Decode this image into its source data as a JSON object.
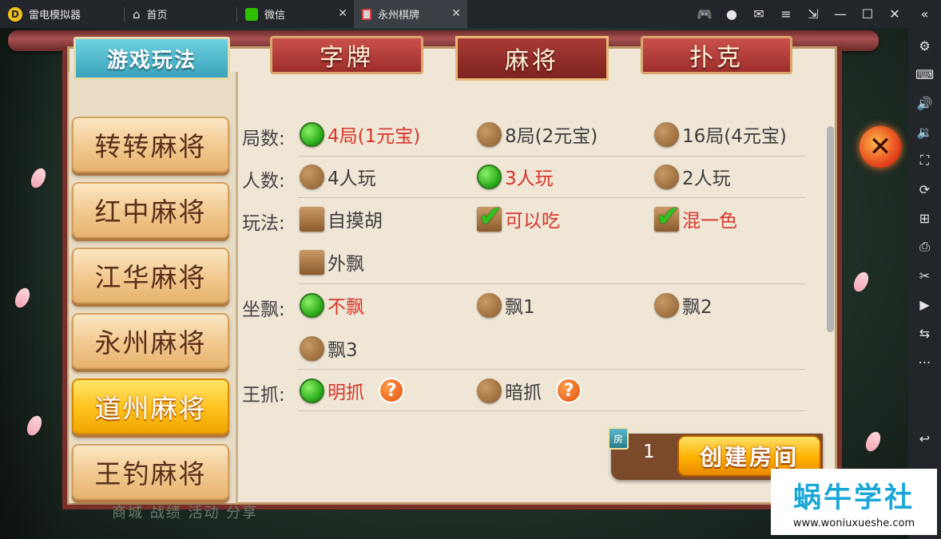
{
  "titlebar": {
    "tabs": [
      {
        "label": "雷电模拟器",
        "icon": "app-logo-icon"
      },
      {
        "label": "首页",
        "icon": "home-icon"
      },
      {
        "label": "微信",
        "icon": "wechat-icon"
      },
      {
        "label": "永州棋牌",
        "icon": "game-icon"
      }
    ],
    "close_glyph": "✕"
  },
  "game": {
    "rules_tab": "游戏玩法",
    "category_tabs": [
      {
        "label": "字牌"
      },
      {
        "label": "麻将"
      },
      {
        "label": "扑克"
      }
    ],
    "active_category": "麻将",
    "game_list": [
      {
        "label": "转转麻将"
      },
      {
        "label": "红中麻将"
      },
      {
        "label": "江华麻将"
      },
      {
        "label": "永州麻将"
      },
      {
        "label": "道州麻将"
      },
      {
        "label": "王钓麻将"
      }
    ],
    "active_game": "道州麻将",
    "rows": {
      "rounds": {
        "label": "局数:",
        "options": [
          "4局(1元宝)",
          "8局(2元宝)",
          "16局(4元宝)"
        ]
      },
      "players": {
        "label": "人数:",
        "options": [
          "4人玩",
          "3人玩",
          "2人玩"
        ]
      },
      "play": {
        "label": "玩法:",
        "options": [
          "自摸胡",
          "可以吃",
          "混一色",
          "外飘"
        ]
      },
      "piao": {
        "label": "坐飘:",
        "options": [
          "不飘",
          "飘1",
          "飘2",
          "飘3"
        ]
      },
      "wang": {
        "label": "王抓:",
        "options": [
          "明抓",
          "暗抓"
        ]
      }
    },
    "help_glyph": "?",
    "cost_value": "1",
    "gem_label": "房",
    "create_button": "创建房间",
    "close_glyph": "✕",
    "bottom_menu": "商城   战绩   活动   分享",
    "bottom_right": "创建房"
  },
  "watermark": {
    "title": "蜗牛学社",
    "url": "www.woniuxueshe.com"
  },
  "colors": {
    "selected_text": "#d8352a",
    "accent_gold": "#ffb000",
    "panel_bg": "#efe6d6"
  }
}
